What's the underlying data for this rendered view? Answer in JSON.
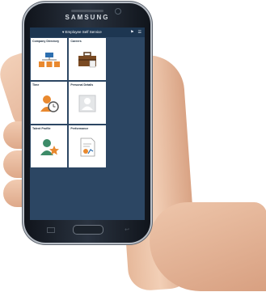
{
  "device": {
    "brand": "SAMSUNG"
  },
  "header": {
    "title": "Employee Self Service",
    "caret": "▾",
    "icons": [
      "flag-icon",
      "menu-icon"
    ]
  },
  "tiles": [
    {
      "label": "Company Directory",
      "icon": "org-chart-icon"
    },
    {
      "label": "Careers",
      "icon": "briefcase-icon"
    },
    {
      "label": "",
      "icon": ""
    },
    {
      "label": "Time",
      "icon": "clock-person-icon"
    },
    {
      "label": "Personal Details",
      "icon": "person-card-icon"
    },
    {
      "label": "",
      "icon": ""
    },
    {
      "label": "Talent Profile",
      "icon": "star-person-icon"
    },
    {
      "label": "Performance",
      "icon": "performance-document-icon"
    },
    {
      "label": "",
      "icon": ""
    }
  ],
  "colors": {
    "screen_bg": "#2c4663",
    "header_bg": "#1d3651",
    "tile_bg": "#ffffff",
    "accent_orange": "#e9892f",
    "accent_blue": "#2d6fb0"
  }
}
